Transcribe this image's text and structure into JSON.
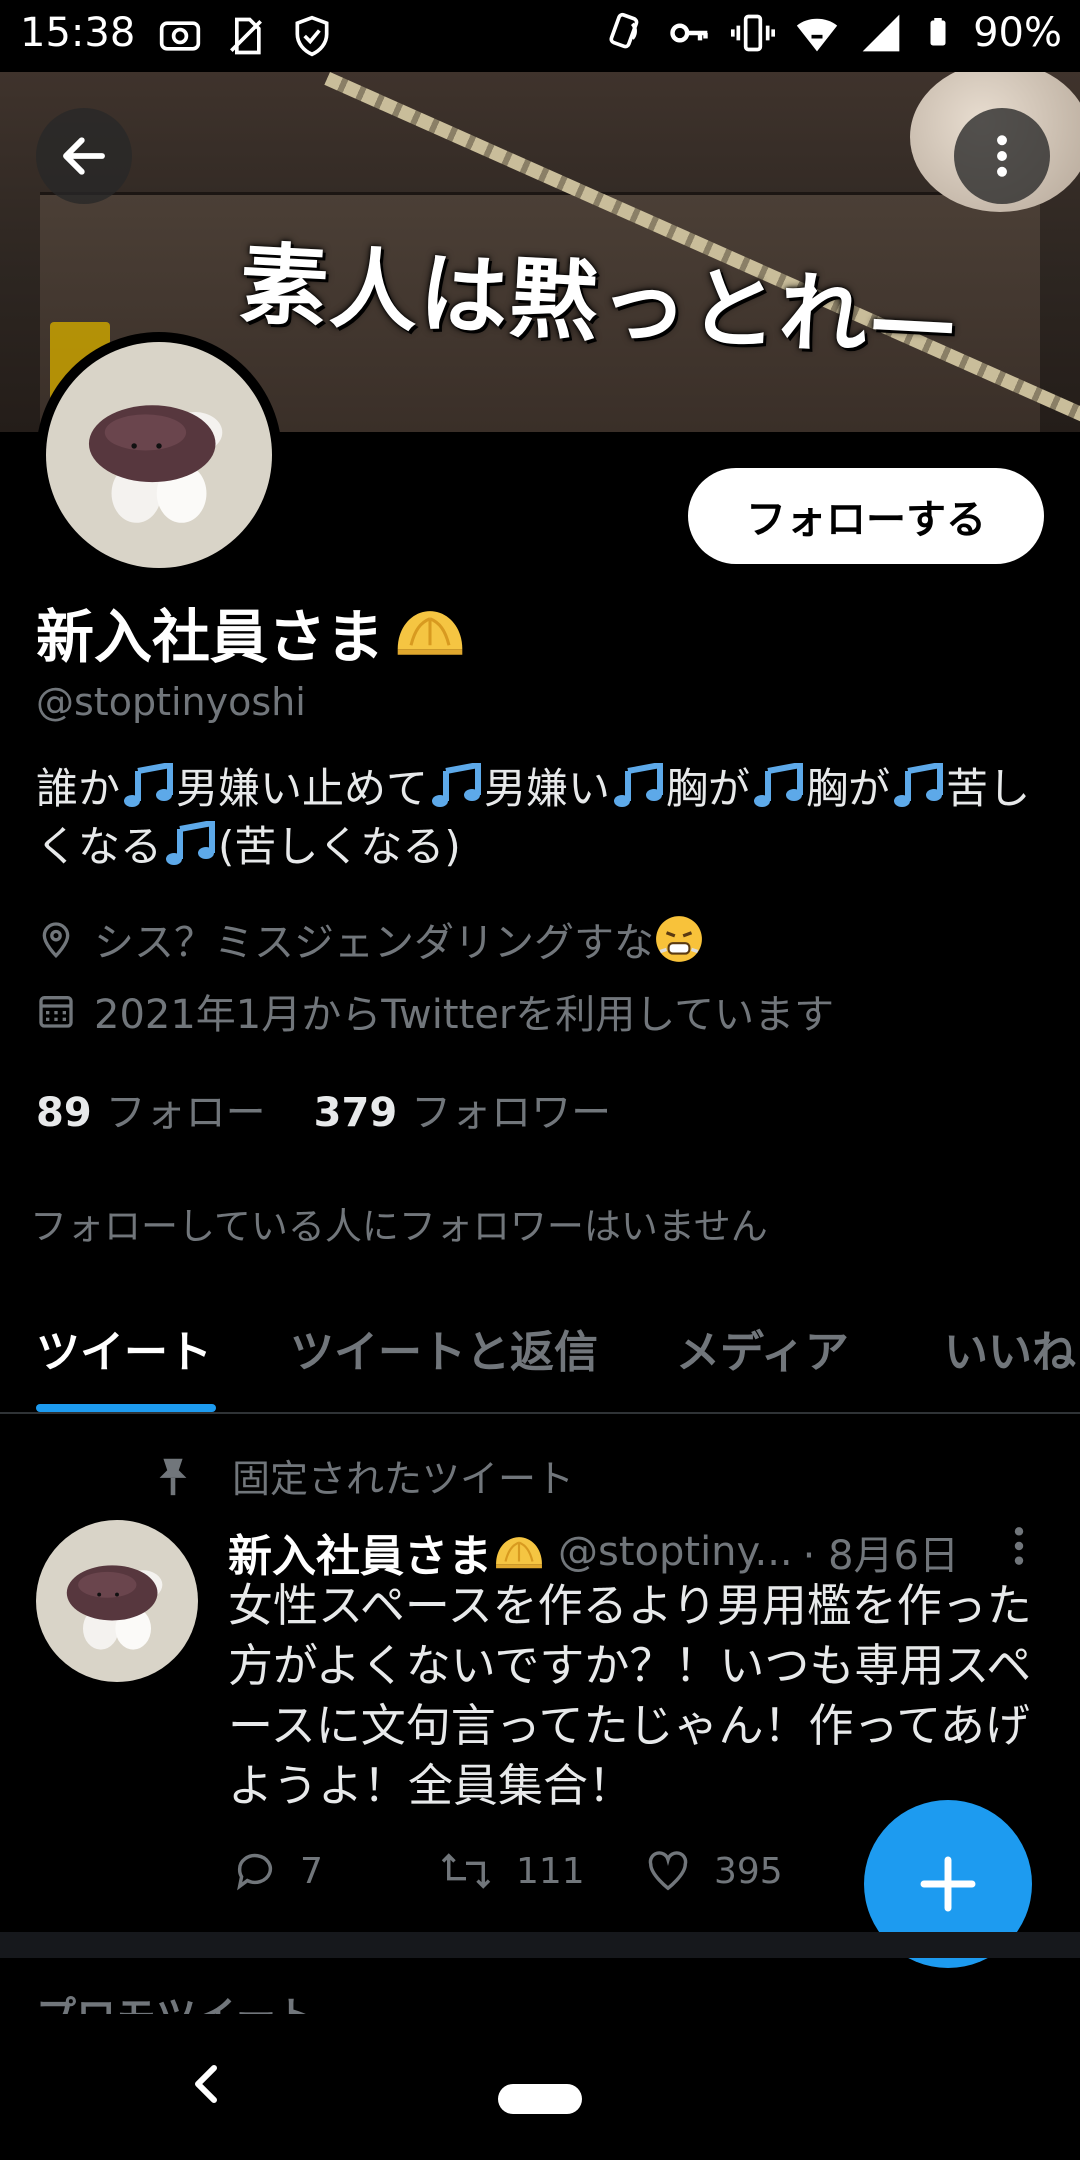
{
  "status_bar": {
    "time": "15:38",
    "battery": "90%",
    "icons": [
      "screenshot-icon",
      "no-sim-icon",
      "shield-icon",
      "nfc-icon",
      "vpn-key-icon",
      "vibrate-icon",
      "wifi-icon",
      "signal-icon",
      "battery-icon"
    ]
  },
  "banner": {
    "caption": "素人は黙っとれ—"
  },
  "profile": {
    "follow_label": "フォローする",
    "display_name": "新入社員さま",
    "name_emoji": "bun-emoji",
    "handle": "@stoptinyoshi",
    "bio_segments": [
      "誰か",
      "男嫌い止めて",
      "男嫌い",
      "胸が",
      "胸が",
      "苦しくなる",
      "(苦しくなる)"
    ],
    "bio_emoji": "musical-notes-emoji",
    "location": "シス？ミスジェンダリングすな",
    "location_emoji": "angry-face-emoji",
    "joined": "2021年1月からTwitterを利用しています",
    "following_count": "89",
    "following_label": "フォロー",
    "followers_count": "379",
    "followers_label": "フォロワー",
    "no_mutual": "フォローしている人にフォロワーはいません"
  },
  "tabs": [
    "ツイート",
    "ツイートと返信",
    "メディア",
    "いいね"
  ],
  "active_tab": 0,
  "pinned_tweet": {
    "pinned_label": "固定されたツイート",
    "name": "新入社員さま",
    "handle": "@stoptiny...",
    "date": "· 8月6日",
    "text": "女性スペースを作るより男用檻を作った方がよくないですか？！いつも専用スペースに文句言ってたじゃん！作ってあげようよ！全員集合！",
    "replies": "7",
    "retweets": "111",
    "likes": "395"
  },
  "promo_label": "プロモツイート",
  "colors": {
    "accent": "#1d9bf0",
    "muted": "#71767b",
    "background": "#000000"
  }
}
